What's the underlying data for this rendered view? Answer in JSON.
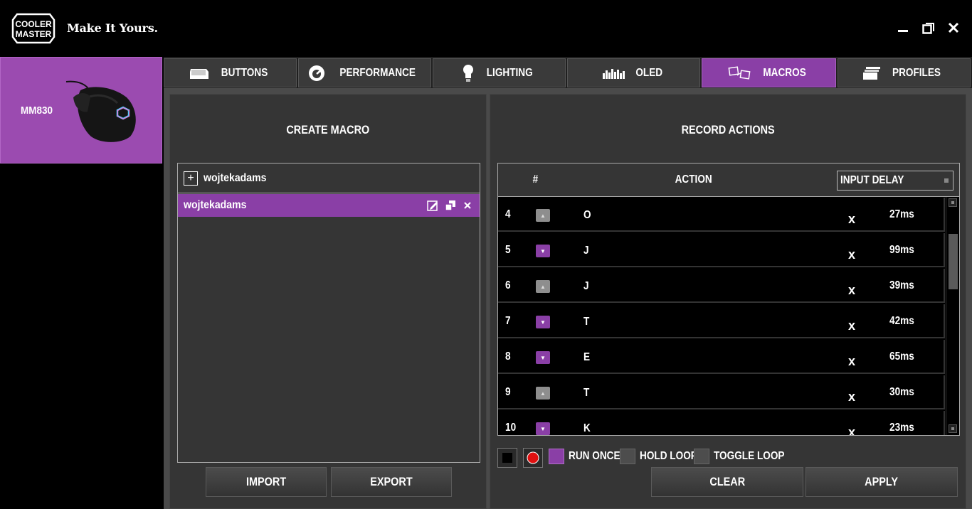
{
  "app": {
    "brand_line1": "COOLER",
    "brand_line2": "MASTER",
    "tagline": "Make It Yours."
  },
  "device": {
    "name": "MM830"
  },
  "tabs": [
    {
      "label": "BUTTONS",
      "icon": "keycap-icon",
      "active": false
    },
    {
      "label": "PERFORMANCE",
      "icon": "gauge-icon",
      "active": false
    },
    {
      "label": "LIGHTING",
      "icon": "bulb-icon",
      "active": false
    },
    {
      "label": "OLED",
      "icon": "equalizer-icon",
      "active": false
    },
    {
      "label": "MACROS",
      "icon": "macro-keys-icon",
      "active": true
    },
    {
      "label": "PROFILES",
      "icon": "stack-icon",
      "active": false
    }
  ],
  "create_macro": {
    "title": "CREATE MACRO",
    "new_macro_name": "wojtekadams",
    "selected_macro": "wojtekadams",
    "import_label": "IMPORT",
    "export_label": "EXPORT"
  },
  "record_actions": {
    "title": "RECORD ACTIONS",
    "col_num": "#",
    "col_action": "ACTION",
    "input_delay": "INPUT DELAY",
    "rows": [
      {
        "num": "4",
        "dir": "up",
        "key": "O",
        "remove": "x",
        "delay": "27ms"
      },
      {
        "num": "5",
        "dir": "down",
        "key": "J",
        "remove": "x",
        "delay": "99ms"
      },
      {
        "num": "6",
        "dir": "up",
        "key": "J",
        "remove": "x",
        "delay": "39ms"
      },
      {
        "num": "7",
        "dir": "down",
        "key": "T",
        "remove": "x",
        "delay": "42ms"
      },
      {
        "num": "8",
        "dir": "down",
        "key": "E",
        "remove": "x",
        "delay": "65ms"
      },
      {
        "num": "9",
        "dir": "up",
        "key": "T",
        "remove": "x",
        "delay": "30ms"
      },
      {
        "num": "10",
        "dir": "down",
        "key": "K",
        "remove": "x",
        "delay": "23ms"
      }
    ],
    "run_once": "RUN ONCE",
    "hold_loop": "HOLD LOOP",
    "toggle_loop": "TOGGLE LOOP",
    "clear_label": "CLEAR",
    "apply_label": "APPLY"
  },
  "colors": {
    "accent": "#8a3fa6",
    "device_card": "#9b4bb0",
    "panel": "#353535"
  }
}
